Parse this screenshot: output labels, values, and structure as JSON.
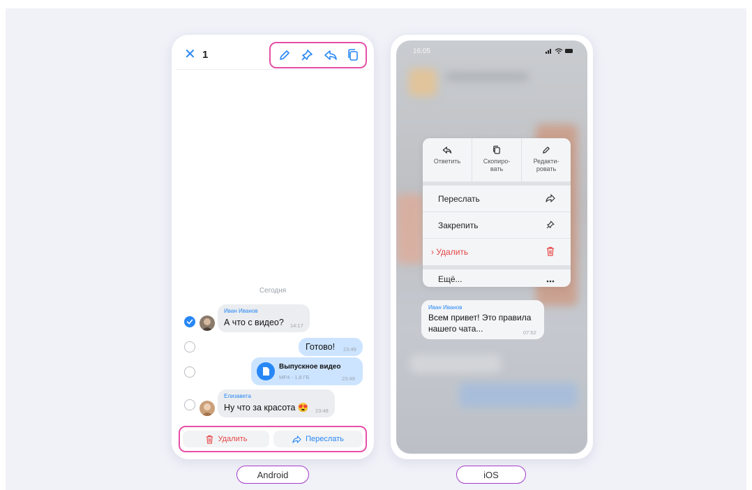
{
  "android": {
    "label": "Android",
    "header": {
      "close_glyph": "✕",
      "selected_count": "1",
      "tools": [
        "pencil-icon",
        "pin-icon",
        "reply-icon",
        "copy-icon"
      ]
    },
    "date_separator": "Сегодня",
    "messages": [
      {
        "sender": "Иван Иванов",
        "text": "А что с видео?",
        "time": "14:17",
        "direction": "in",
        "selected": true
      },
      {
        "text": "Готово!",
        "time": "23:49",
        "direction": "out",
        "selected": false
      },
      {
        "file_name": "Выпускное видео",
        "file_meta": "MP4 - 1,8 ГБ",
        "time": "23:49",
        "direction": "out",
        "selected": false
      },
      {
        "sender": "Елизавета",
        "text": "Ну что за красота 😍",
        "time": "23:48",
        "direction": "in",
        "selected": false
      }
    ],
    "actions": {
      "delete_label": "Удалить",
      "forward_label": "Переслать"
    }
  },
  "ios": {
    "label": "iOS",
    "status_time": "16:05",
    "top_actions": [
      {
        "label": "Ответить",
        "icon": "reply-icon"
      },
      {
        "label": "Скопиро-\nвать",
        "icon": "copy-icon"
      },
      {
        "label": "Редакти-\nровать",
        "icon": "pencil-icon"
      }
    ],
    "menu_items": [
      {
        "label": "Переслать",
        "icon": "forward-icon"
      },
      {
        "label": "Закрепить",
        "icon": "pin-icon"
      },
      {
        "label": "› Удалить",
        "icon": "trash-icon",
        "destructive": true
      },
      {
        "label": "Ещё...",
        "icon": "more-icon"
      }
    ],
    "message": {
      "sender": "Иван Иванов",
      "text_line1": "Всем привет! Это правила",
      "text_line2": "нашего чата...",
      "time": "07:52"
    }
  },
  "colors": {
    "accent": "#2787f5",
    "highlight": "#e64fa6",
    "destructive": "#e64646",
    "pill_border": "#a23cc8"
  }
}
